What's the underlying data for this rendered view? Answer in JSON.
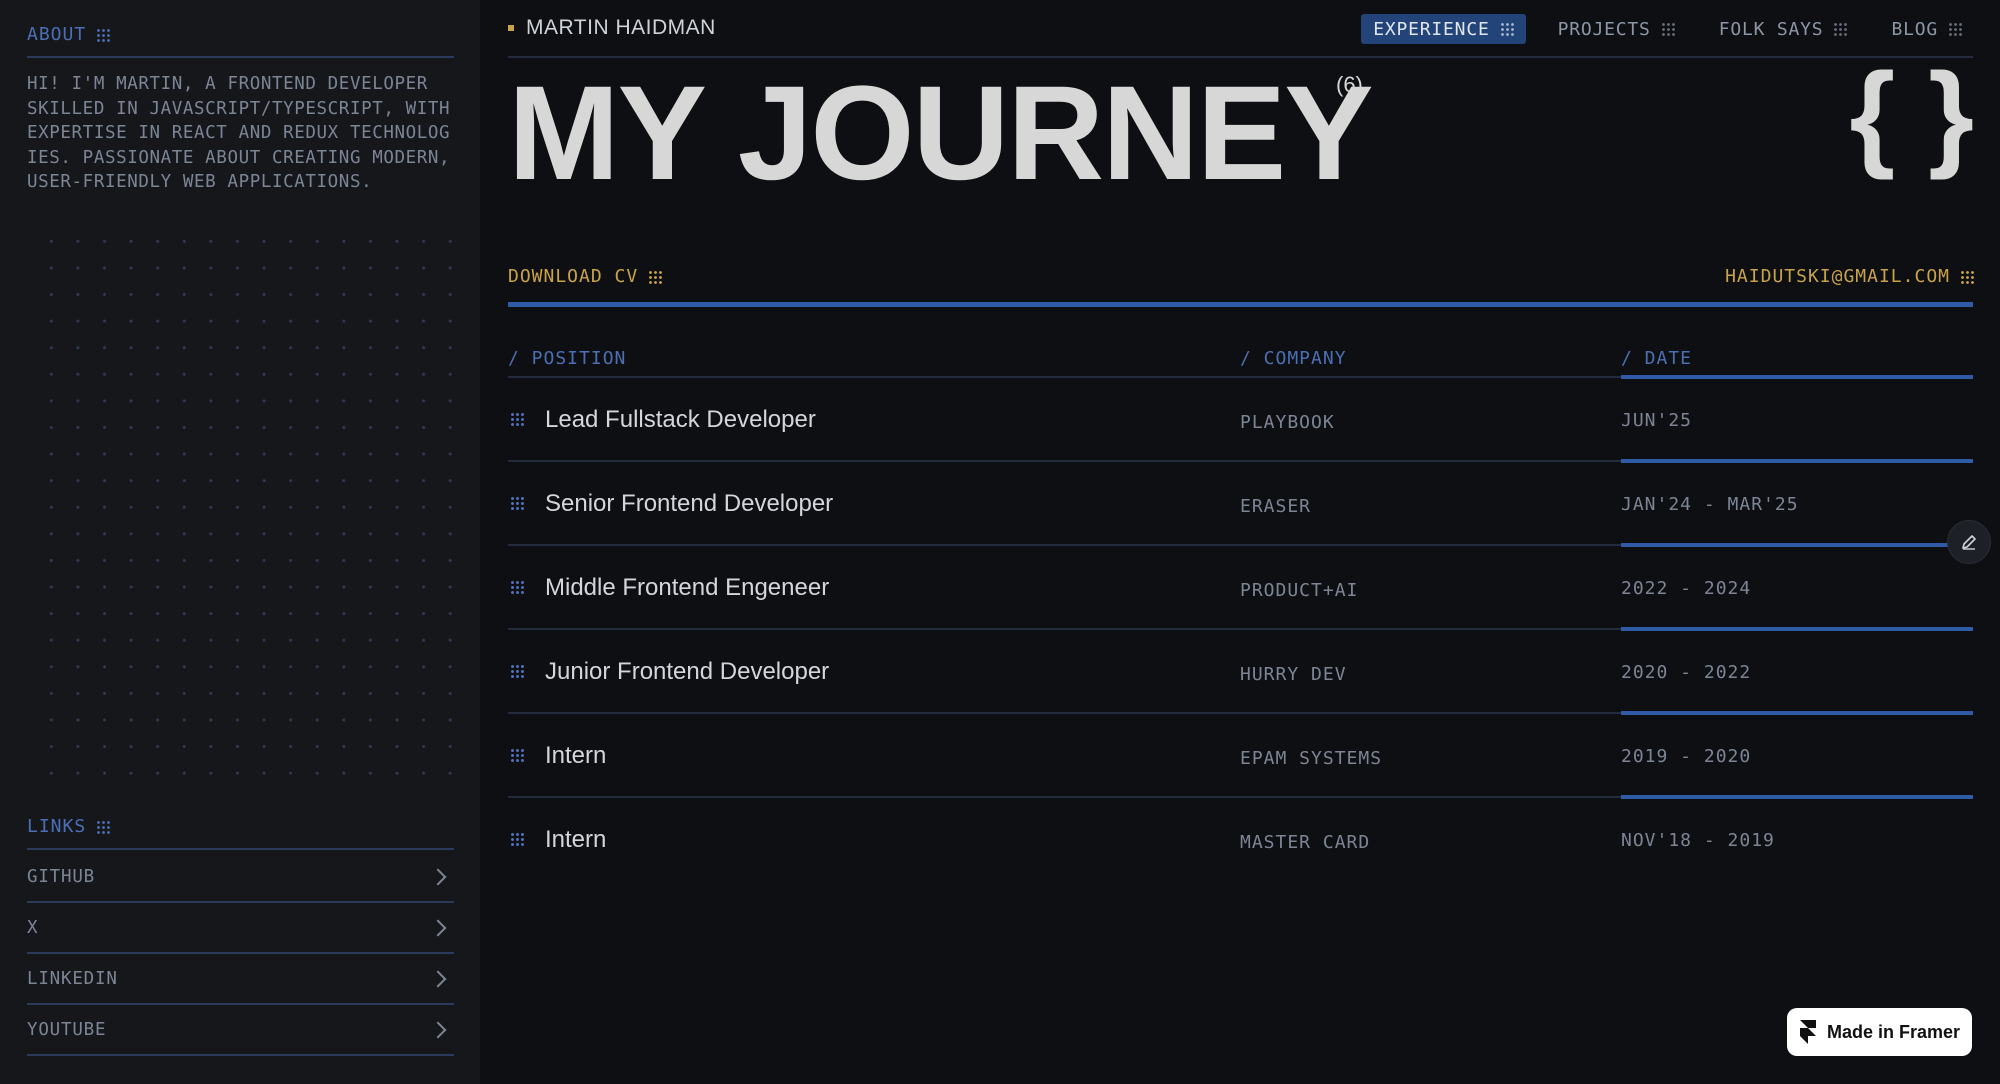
{
  "sidebar": {
    "about_title": "ABOUT",
    "about_text": "HI! I'M MARTIN, A FRONTEND DEVELOPER\nSKILLED IN JAVASCRIPT/TYPESCRIPT, WITH\nEXPERTISE IN REACT AND REDUX TECHNOLOG\nIES. PASSIONATE ABOUT CREATING MODERN,\nUSER-FRIENDLY WEB APPLICATIONS.",
    "links_title": "LINKS",
    "links": [
      {
        "label": "GITHUB"
      },
      {
        "label": "X"
      },
      {
        "label": "LINKEDIN"
      },
      {
        "label": "YOUTUBE"
      }
    ]
  },
  "header": {
    "brand": "MARTIN HAIDMAN",
    "nav": [
      {
        "label": "EXPERIENCE",
        "active": true
      },
      {
        "label": "PROJECTS",
        "active": false
      },
      {
        "label": "FOLK SAYS",
        "active": false
      },
      {
        "label": "BLOG",
        "active": false
      }
    ]
  },
  "hero": {
    "title": "MY JOURNEY",
    "count": "(6)",
    "braces": "{ }"
  },
  "actions": {
    "download_cv": "DOWNLOAD CV",
    "email": "HAIDUTSKI@GMAIL.COM"
  },
  "table": {
    "headers": {
      "position": "/ POSITION",
      "company": "/ COMPANY",
      "date": "/ DATE"
    },
    "rows": [
      {
        "position": "Lead Fullstack Developer",
        "company": "PLAYBOOK",
        "date": "JUN'25"
      },
      {
        "position": "Senior Frontend Developer",
        "company": "ERASER",
        "date": "JAN'24 - MAR'25"
      },
      {
        "position": "Middle Frontend Engeneer",
        "company": "PRODUCT+AI",
        "date": "2022 - 2024"
      },
      {
        "position": "Junior Frontend Developer",
        "company": "HURRY DEV",
        "date": "2020 - 2022"
      },
      {
        "position": "Intern",
        "company": "EPAM SYSTEMS",
        "date": "2019 - 2020"
      },
      {
        "position": "Intern",
        "company": "MASTER CARD",
        "date": "NOV'18 - 2019"
      }
    ]
  },
  "badge": {
    "label": "Made in Framer"
  },
  "colors": {
    "accent_blue": "#2e5aa6",
    "accent_gold": "#c9a34a",
    "background": "#0e0f12"
  }
}
